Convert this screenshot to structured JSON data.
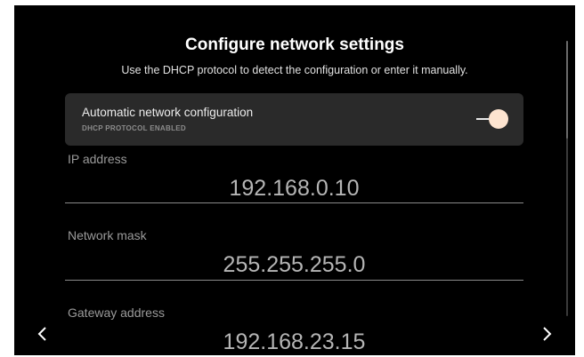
{
  "header": {
    "title": "Configure network settings",
    "subtitle": "Use the DHCP protocol to detect the configuration or enter it manually."
  },
  "auto_config": {
    "label": "Automatic network configuration",
    "status": "DHCP PROTOCOL ENABLED",
    "toggle_on": true
  },
  "fields": {
    "ip": {
      "label": "IP address",
      "value": "192.168.0.10"
    },
    "mask": {
      "label": "Network mask",
      "value": "255.255.255.0"
    },
    "gateway": {
      "label": "Gateway address",
      "value": "192.168.23.15"
    }
  },
  "nav": {
    "prev_icon": "chevron-left-icon",
    "next_icon": "chevron-right-icon"
  },
  "colors": {
    "background": "#000000",
    "card": "#2a2a2a",
    "toggle_knob": "#fde4d0"
  }
}
